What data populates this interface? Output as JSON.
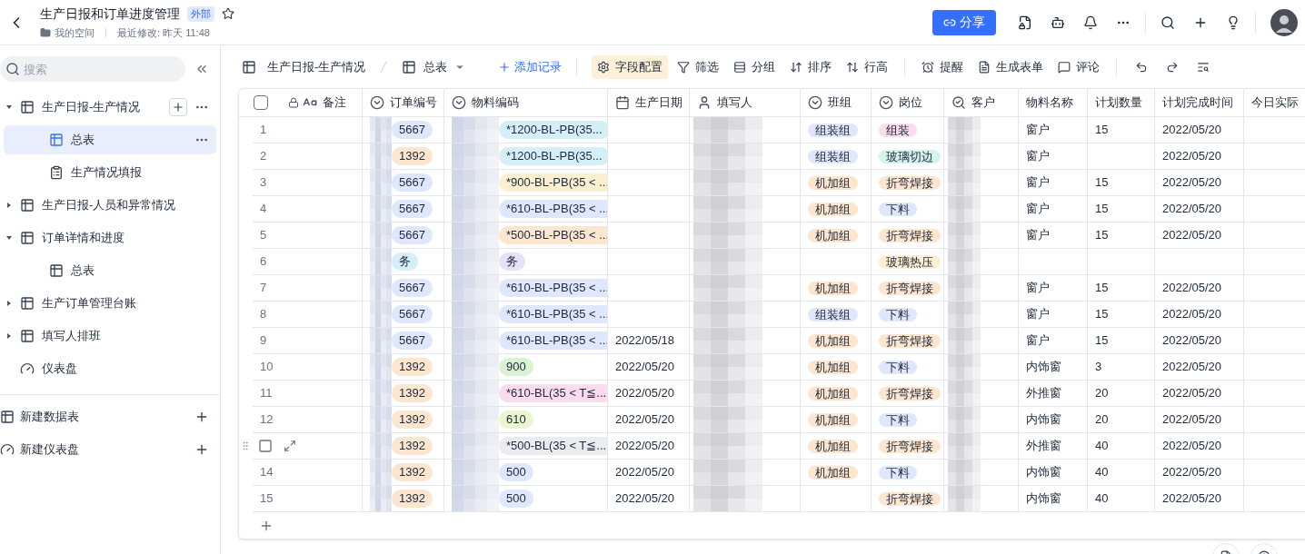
{
  "header": {
    "title": "生产日报和订单进度管理",
    "badge": "外部",
    "starred": false,
    "location": "我的空间",
    "modified": "最近修改: 昨天 11:48",
    "share": "分享"
  },
  "sidebar": {
    "search_placeholder": "搜索",
    "items": [
      {
        "label": "生产日报-生产情况",
        "kind": "table",
        "expanded": true,
        "selected": false,
        "children": [
          {
            "label": "总表",
            "kind": "table",
            "selected": true
          },
          {
            "label": "生产情况填报",
            "kind": "form",
            "selected": false
          }
        ]
      },
      {
        "label": "生产日报-人员和异常情况",
        "kind": "table",
        "expanded": false,
        "selected": false
      },
      {
        "label": "订单详情和进度",
        "kind": "table",
        "expanded": true,
        "selected": false,
        "children": [
          {
            "label": "总表",
            "kind": "table",
            "selected": false
          }
        ]
      },
      {
        "label": "生产订单管理台账",
        "kind": "table",
        "expanded": false,
        "selected": false
      },
      {
        "label": "填写人排班",
        "kind": "table",
        "expanded": false,
        "selected": false
      },
      {
        "label": "仪表盘",
        "kind": "dashboard",
        "selected": false
      }
    ],
    "create": [
      {
        "label": "新建数据表",
        "kind": "table"
      },
      {
        "label": "新建仪表盘",
        "kind": "dashboard"
      }
    ]
  },
  "toolbar": {
    "table_name": "生产日报-生产情况",
    "view": "总表",
    "add": "添加记录",
    "actions": [
      {
        "label": "字段配置",
        "kind": "fields",
        "selected": true
      },
      {
        "label": "筛选",
        "kind": "filter",
        "selected": false
      },
      {
        "label": "分组",
        "kind": "group",
        "selected": false
      },
      {
        "label": "排序",
        "kind": "sort",
        "selected": false
      },
      {
        "label": "行高",
        "kind": "height",
        "selected": false
      },
      {
        "label": "提醒",
        "kind": "remind",
        "selected": false
      },
      {
        "label": "生成表单",
        "kind": "form",
        "selected": false
      },
      {
        "label": "评论",
        "kind": "comment",
        "selected": false
      }
    ]
  },
  "table": {
    "select_all": false,
    "columns": [
      {
        "label": "备注",
        "kind": "text"
      },
      {
        "label": "订单编号",
        "kind": "select"
      },
      {
        "label": "物料编码",
        "kind": "select"
      },
      {
        "label": "生产日期",
        "kind": "date"
      },
      {
        "label": "填写人",
        "kind": "person"
      },
      {
        "label": "班组",
        "kind": "select"
      },
      {
        "label": "岗位",
        "kind": "select"
      },
      {
        "label": "客户",
        "kind": "lookup"
      },
      {
        "label": "物料名称",
        "kind": "plain"
      },
      {
        "label": "计划数量",
        "kind": "plain"
      },
      {
        "label": "计划完成时间",
        "kind": "plain"
      },
      {
        "label": "今日实际",
        "kind": "plain"
      }
    ],
    "rows": [
      {
        "number": "1",
        "hovered": false,
        "order": {
          "text": "5667",
          "color": "#dee7fc"
        },
        "material": {
          "text": "*1200-BL-PB(35...",
          "color": "#d5eff8"
        },
        "team": {
          "text": "组装组",
          "color": "#dee7fc"
        },
        "post": {
          "text": "组装",
          "color": "#fbdcec"
        },
        "name": "窗户",
        "qty": "15",
        "due": "2022/05/20"
      },
      {
        "number": "2",
        "hovered": false,
        "order": {
          "text": "1392",
          "color": "#fde6cf"
        },
        "material": {
          "text": "*1200-BL-PB(35...",
          "color": "#d5eff8"
        },
        "team": {
          "text": "组装组",
          "color": "#dee7fc"
        },
        "post": {
          "text": "玻璃切边",
          "color": "#d4f3ec"
        },
        "name": "窗户",
        "due": "2022/05/20"
      },
      {
        "number": "3",
        "hovered": false,
        "order": {
          "text": "5667",
          "color": "#dee7fc"
        },
        "material": {
          "text": "*900-BL-PB(35 < ...",
          "color": "#faf0cf"
        },
        "team": {
          "text": "机加组",
          "color": "#fde6cf"
        },
        "post": {
          "text": "折弯焊接",
          "color": "#fde6cf"
        },
        "name": "窗户",
        "qty": "15",
        "due": "2022/05/20"
      },
      {
        "number": "4",
        "hovered": false,
        "order": {
          "text": "5667",
          "color": "#dee7fc"
        },
        "material": {
          "text": "*610-BL-PB(35 < ...",
          "color": "#dee7fc"
        },
        "team": {
          "text": "机加组",
          "color": "#fde6cf"
        },
        "post": {
          "text": "下料",
          "color": "#dee7fc"
        },
        "name": "窗户",
        "qty": "15",
        "due": "2022/05/20"
      },
      {
        "number": "5",
        "hovered": false,
        "order": {
          "text": "5667",
          "color": "#dee7fc"
        },
        "material": {
          "text": "*500-BL-PB(35 < ...",
          "color": "#fde6cf"
        },
        "team": {
          "text": "机加组",
          "color": "#fde6cf"
        },
        "post": {
          "text": "折弯焊接",
          "color": "#fde6cf"
        },
        "name": "窗户",
        "qty": "15",
        "due": "2022/05/20"
      },
      {
        "number": "6",
        "hovered": false,
        "order": {
          "text": "务",
          "color": "#d5eff8"
        },
        "material": {
          "text": "务",
          "color": "#e8e0f8"
        },
        "post": {
          "text": "玻璃热压",
          "color": "#faf0cf"
        }
      },
      {
        "number": "7",
        "hovered": false,
        "order": {
          "text": "5667",
          "color": "#dee7fc"
        },
        "material": {
          "text": "*610-BL-PB(35 < ...",
          "color": "#dee7fc"
        },
        "team": {
          "text": "机加组",
          "color": "#fde6cf"
        },
        "post": {
          "text": "折弯焊接",
          "color": "#fde6cf"
        },
        "name": "窗户",
        "qty": "15",
        "due": "2022/05/20"
      },
      {
        "number": "8",
        "hovered": false,
        "order": {
          "text": "5667",
          "color": "#dee7fc"
        },
        "material": {
          "text": "*610-BL-PB(35 < ...",
          "color": "#dee7fc"
        },
        "team": {
          "text": "组装组",
          "color": "#dee7fc"
        },
        "post": {
          "text": "下料",
          "color": "#dee7fc"
        },
        "name": "窗户",
        "qty": "15",
        "due": "2022/05/20"
      },
      {
        "number": "9",
        "hovered": false,
        "order": {
          "text": "5667",
          "color": "#dee7fc"
        },
        "material": {
          "text": "*610-BL-PB(35 < ...",
          "color": "#dee7fc"
        },
        "date": "2022/05/18",
        "team": {
          "text": "机加组",
          "color": "#fde6cf"
        },
        "post": {
          "text": "折弯焊接",
          "color": "#fde6cf"
        },
        "name": "窗户",
        "qty": "15",
        "due": "2022/05/20"
      },
      {
        "number": "10",
        "hovered": false,
        "order": {
          "text": "1392",
          "color": "#fde6cf"
        },
        "material": {
          "text": "900",
          "color": "#d9f2d3"
        },
        "date": "2022/05/20",
        "team": {
          "text": "机加组",
          "color": "#fde6cf"
        },
        "post": {
          "text": "下料",
          "color": "#dee7fc"
        },
        "name": "内饰窗",
        "qty": "3",
        "due": "2022/05/20"
      },
      {
        "number": "11",
        "hovered": false,
        "order": {
          "text": "1392",
          "color": "#fde6cf"
        },
        "material": {
          "text": "*610-BL(35 < T≦...",
          "color": "#fbdcef"
        },
        "date": "2022/05/20",
        "team": {
          "text": "机加组",
          "color": "#fde6cf"
        },
        "post": {
          "text": "折弯焊接",
          "color": "#fde6cf"
        },
        "name": "外推窗",
        "qty": "20",
        "due": "2022/05/20"
      },
      {
        "number": "12",
        "hovered": false,
        "order": {
          "text": "1392",
          "color": "#fde6cf"
        },
        "material": {
          "text": "610",
          "color": "#ebf5cf"
        },
        "date": "2022/05/20",
        "team": {
          "text": "机加组",
          "color": "#fde6cf"
        },
        "post": {
          "text": "下料",
          "color": "#dee7fc"
        },
        "name": "内饰窗",
        "qty": "20",
        "due": "2022/05/20"
      },
      {
        "hovered": true,
        "order": {
          "text": "1392",
          "color": "#fde6cf"
        },
        "material": {
          "text": "*500-BL(35 < T≦...",
          "color": "#ebecef"
        },
        "date": "2022/05/20",
        "team": {
          "text": "机加组",
          "color": "#fde6cf"
        },
        "post": {
          "text": "折弯焊接",
          "color": "#fde6cf"
        },
        "name": "外推窗",
        "qty": "40",
        "due": "2022/05/20"
      },
      {
        "number": "14",
        "hovered": false,
        "order": {
          "text": "1392",
          "color": "#fde6cf"
        },
        "material": {
          "text": "500",
          "color": "#dee7fc"
        },
        "date": "2022/05/20",
        "team": {
          "text": "机加组",
          "color": "#fde6cf"
        },
        "post": {
          "text": "下料",
          "color": "#dee7fc"
        },
        "name": "内饰窗",
        "qty": "40",
        "due": "2022/05/20"
      },
      {
        "number": "15",
        "hovered": false,
        "order": {
          "text": "1392",
          "color": "#fde6cf"
        },
        "material": {
          "text": "500",
          "color": "#dee7fc"
        },
        "date": "2022/05/20",
        "post": {
          "text": "折弯焊接",
          "color": "#fde6cf"
        },
        "name": "内饰窗",
        "qty": "40",
        "due": "2022/05/20"
      }
    ]
  }
}
